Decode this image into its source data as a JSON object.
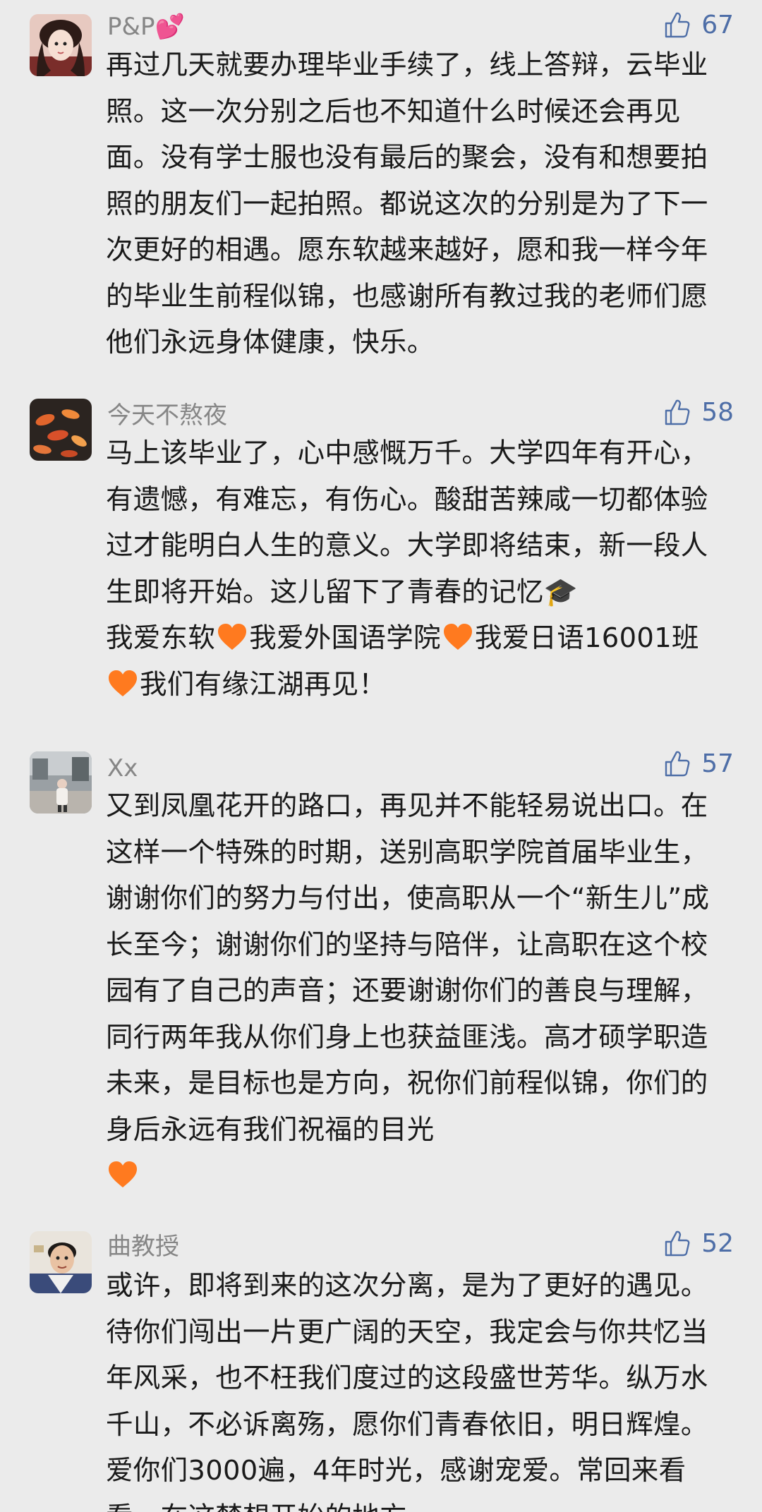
{
  "colors": {
    "background": "#ebebeb",
    "username": "#868686",
    "like_count": "#4e6ea7",
    "heart": "#ff7a1f"
  },
  "comments": [
    {
      "user": "P&P💕",
      "likes": "67",
      "text": "再过几天就要办理毕业手续了，线上答辩，云毕业照。这一次分别之后也不知道什么时候还会再见面。没有学士服也没有最后的聚会，没有和想要拍照的朋友们一起拍照。都说这次的分别是为了下一次更好的相遇。愿东软越来越好，愿和我一样今年的毕业生前程似锦，也感谢所有教过我的老师们愿他们永远身体健康，快乐。"
    },
    {
      "user": "今天不熬夜",
      "likes": "58",
      "text_parts": [
        "马上该毕业了，心中感慨万千。大学四年有开心，有遗憾，有难忘，有伤心。酸甜苦辣咸一切都体验过才能明白人生的意义。大学即将结束，新一段人生即将开始。这儿留下了青春的记忆🎓",
        "我爱东软",
        "我爱外国语学院",
        "我爱日语16001班",
        "我们有缘江湖再见！"
      ]
    },
    {
      "user": "Xx",
      "likes": "57",
      "text": "又到凤凰花开的路口，再见并不能轻易说出口。在这样一个特殊的时期，送别高职学院首届毕业生，谢谢你们的努力与付出，使高职从一个“新生儿”成长至今；谢谢你们的坚持与陪伴，让高职在这个校园有了自己的声音；还要谢谢你们的善良与理解，同行两年我从你们身上也获益匪浅。高才硕学职造未来，是目标也是方向，祝你们前程似锦，你们的身后永远有我们祝福的目光"
    },
    {
      "user": "曲教授",
      "likes": "52",
      "text": "或许，即将到来的这次分离，是为了更好的遇见。待你们闯出一片更广阔的天空，我定会与你共忆当年风采，也不枉我们度过的这段盛世芳华。纵万水千山，不必诉离殇，愿你们青春依旧，明日辉煌。爱你们3000遍，4年时光，感谢宠爱。常回来看看，在这梦想开始的地方。"
    }
  ],
  "icons": {
    "like": "thumbs-up-icon",
    "heart": "orange-heart-emoji"
  }
}
